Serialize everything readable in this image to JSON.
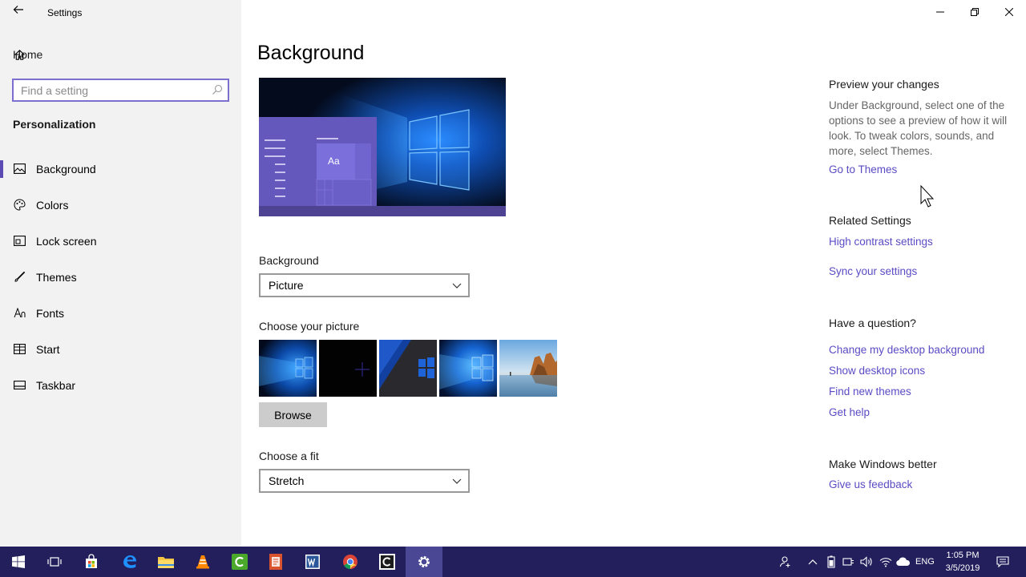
{
  "app": {
    "title": "Settings"
  },
  "sidebar": {
    "home_label": "Home",
    "search_placeholder": "Find a setting",
    "section_title": "Personalization",
    "items": [
      {
        "label": "Background",
        "icon": "picture-icon",
        "active": true
      },
      {
        "label": "Colors",
        "icon": "palette-icon"
      },
      {
        "label": "Lock screen",
        "icon": "lock-screen-icon"
      },
      {
        "label": "Themes",
        "icon": "brush-icon"
      },
      {
        "label": "Fonts",
        "icon": "font-icon"
      },
      {
        "label": "Start",
        "icon": "start-icon"
      },
      {
        "label": "Taskbar",
        "icon": "taskbar-icon"
      }
    ]
  },
  "main": {
    "title": "Background",
    "preview_sample_text": "Aa",
    "background_label": "Background",
    "background_value": "Picture",
    "choose_picture_label": "Choose your picture",
    "browse_label": "Browse",
    "fit_label": "Choose a fit",
    "fit_value": "Stretch"
  },
  "right": {
    "preview_heading": "Preview your changes",
    "preview_text": "Under Background, select one of the options to see a preview of how it will look. To tweak colors, sounds, and more, select Themes.",
    "go_to_themes": "Go to Themes",
    "related_heading": "Related Settings",
    "related_links": [
      "High contrast settings",
      "Sync your settings"
    ],
    "question_heading": "Have a question?",
    "question_links": [
      "Change my desktop background",
      "Show desktop icons",
      "Find new themes",
      "Get help"
    ],
    "better_heading": "Make Windows better",
    "feedback_link": "Give us feedback"
  },
  "taskbar": {
    "lang": "ENG",
    "time": "1:05 PM",
    "date": "3/5/2019"
  },
  "colors": {
    "accent": "#5b4bb3",
    "link": "#5a4bc4",
    "taskbar": "#221f5c"
  }
}
